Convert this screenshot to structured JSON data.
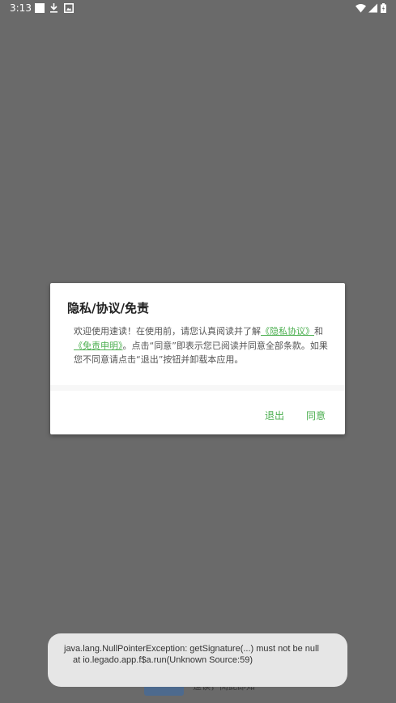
{
  "status_bar": {
    "time": "3:13",
    "icons": [
      "notification-square-icon",
      "download-icon",
      "photo-icon",
      "wifi-icon",
      "signal-icon",
      "battery-icon"
    ]
  },
  "dialog": {
    "title": "隐私/协议/免责",
    "body": {
      "text1": "欢迎使用速读！在使用前，请您认真阅读并了解",
      "link_privacy": "《隐私协议》",
      "text2": "和",
      "link_disclaimer": "《免责申明》",
      "text3": "。点击“同意”即表示您已阅读并同意全部条款。如果您不同意请点击“退出”按钮并卸载本应用。"
    },
    "buttons": {
      "exit": "退出",
      "agree": "同意"
    }
  },
  "background_app": {
    "sub_text": "速读，阅此即知"
  },
  "toast": {
    "line1": "java.lang.NullPointerException: getSignature(...) must not be null",
    "line2": "at io.legado.app.f$a.run(Unknown Source:59)"
  },
  "colors": {
    "scrim": "#6a6a6a",
    "accent": "#4caf50",
    "toast_bg": "#e6e6e6"
  }
}
